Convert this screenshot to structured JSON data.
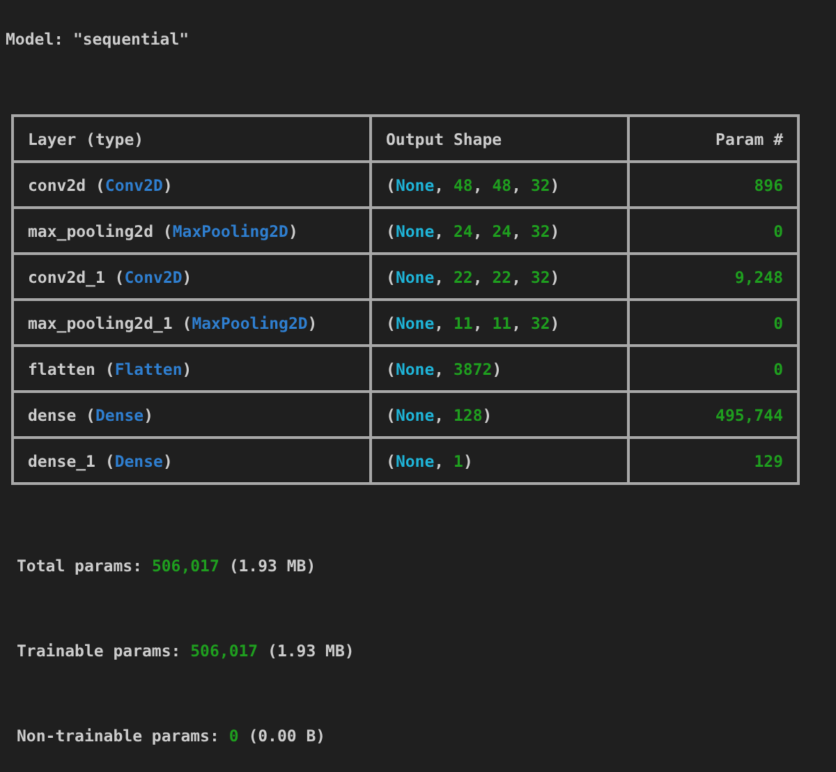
{
  "title": "Model: \"sequential\"",
  "table": {
    "columns": [
      "Layer (type)",
      "Output Shape",
      "Param #"
    ],
    "rows": [
      {
        "layer": [
          {
            "text": "conv2d (",
            "kind": "plain"
          },
          {
            "text": "Conv2D",
            "kind": "type"
          },
          {
            "text": ")",
            "kind": "plain"
          }
        ],
        "shape": [
          {
            "text": "(",
            "kind": "plain"
          },
          {
            "text": "None",
            "kind": "none"
          },
          {
            "text": ", ",
            "kind": "plain"
          },
          {
            "text": "48",
            "kind": "number"
          },
          {
            "text": ", ",
            "kind": "plain"
          },
          {
            "text": "48",
            "kind": "number"
          },
          {
            "text": ", ",
            "kind": "plain"
          },
          {
            "text": "32",
            "kind": "number"
          },
          {
            "text": ")",
            "kind": "plain"
          }
        ],
        "params": "896"
      },
      {
        "layer": [
          {
            "text": "max_pooling2d (",
            "kind": "plain"
          },
          {
            "text": "MaxPooling2D",
            "kind": "type"
          },
          {
            "text": ")",
            "kind": "plain"
          }
        ],
        "shape": [
          {
            "text": "(",
            "kind": "plain"
          },
          {
            "text": "None",
            "kind": "none"
          },
          {
            "text": ", ",
            "kind": "plain"
          },
          {
            "text": "24",
            "kind": "number"
          },
          {
            "text": ", ",
            "kind": "plain"
          },
          {
            "text": "24",
            "kind": "number"
          },
          {
            "text": ", ",
            "kind": "plain"
          },
          {
            "text": "32",
            "kind": "number"
          },
          {
            "text": ")",
            "kind": "plain"
          }
        ],
        "params": "0"
      },
      {
        "layer": [
          {
            "text": "conv2d_1 (",
            "kind": "plain"
          },
          {
            "text": "Conv2D",
            "kind": "type"
          },
          {
            "text": ")",
            "kind": "plain"
          }
        ],
        "shape": [
          {
            "text": "(",
            "kind": "plain"
          },
          {
            "text": "None",
            "kind": "none"
          },
          {
            "text": ", ",
            "kind": "plain"
          },
          {
            "text": "22",
            "kind": "number"
          },
          {
            "text": ", ",
            "kind": "plain"
          },
          {
            "text": "22",
            "kind": "number"
          },
          {
            "text": ", ",
            "kind": "plain"
          },
          {
            "text": "32",
            "kind": "number"
          },
          {
            "text": ")",
            "kind": "plain"
          }
        ],
        "params": "9,248"
      },
      {
        "layer": [
          {
            "text": "max_pooling2d_1 (",
            "kind": "plain"
          },
          {
            "text": "MaxPooling2D",
            "kind": "type"
          },
          {
            "text": ")",
            "kind": "plain"
          }
        ],
        "shape": [
          {
            "text": "(",
            "kind": "plain"
          },
          {
            "text": "None",
            "kind": "none"
          },
          {
            "text": ", ",
            "kind": "plain"
          },
          {
            "text": "11",
            "kind": "number"
          },
          {
            "text": ", ",
            "kind": "plain"
          },
          {
            "text": "11",
            "kind": "number"
          },
          {
            "text": ", ",
            "kind": "plain"
          },
          {
            "text": "32",
            "kind": "number"
          },
          {
            "text": ")",
            "kind": "plain"
          }
        ],
        "params": "0"
      },
      {
        "layer": [
          {
            "text": "flatten (",
            "kind": "plain"
          },
          {
            "text": "Flatten",
            "kind": "type"
          },
          {
            "text": ")",
            "kind": "plain"
          }
        ],
        "shape": [
          {
            "text": "(",
            "kind": "plain"
          },
          {
            "text": "None",
            "kind": "none"
          },
          {
            "text": ", ",
            "kind": "plain"
          },
          {
            "text": "3872",
            "kind": "number"
          },
          {
            "text": ")",
            "kind": "plain"
          }
        ],
        "params": "0"
      },
      {
        "layer": [
          {
            "text": "dense (",
            "kind": "plain"
          },
          {
            "text": "Dense",
            "kind": "type"
          },
          {
            "text": ")",
            "kind": "plain"
          }
        ],
        "shape": [
          {
            "text": "(",
            "kind": "plain"
          },
          {
            "text": "None",
            "kind": "none"
          },
          {
            "text": ", ",
            "kind": "plain"
          },
          {
            "text": "128",
            "kind": "number"
          },
          {
            "text": ")",
            "kind": "plain"
          }
        ],
        "params": "495,744"
      },
      {
        "layer": [
          {
            "text": "dense_1 (",
            "kind": "plain"
          },
          {
            "text": "Dense",
            "kind": "type"
          },
          {
            "text": ")",
            "kind": "plain"
          }
        ],
        "shape": [
          {
            "text": "(",
            "kind": "plain"
          },
          {
            "text": "None",
            "kind": "none"
          },
          {
            "text": ", ",
            "kind": "plain"
          },
          {
            "text": "1",
            "kind": "number"
          },
          {
            "text": ")",
            "kind": "plain"
          }
        ],
        "params": "129"
      }
    ]
  },
  "summary": [
    [
      {
        "text": "Total params: ",
        "kind": "plain"
      },
      {
        "text": "506,017",
        "kind": "number"
      },
      {
        "text": " (1.93 MB)",
        "kind": "plain"
      }
    ],
    [
      {
        "text": "Trainable params: ",
        "kind": "plain"
      },
      {
        "text": "506,017",
        "kind": "number"
      },
      {
        "text": " (1.93 MB)",
        "kind": "plain"
      }
    ],
    [
      {
        "text": "Non-trainable params: ",
        "kind": "plain"
      },
      {
        "text": "0",
        "kind": "number"
      },
      {
        "text": " (0.00 B)",
        "kind": "plain"
      }
    ]
  ]
}
